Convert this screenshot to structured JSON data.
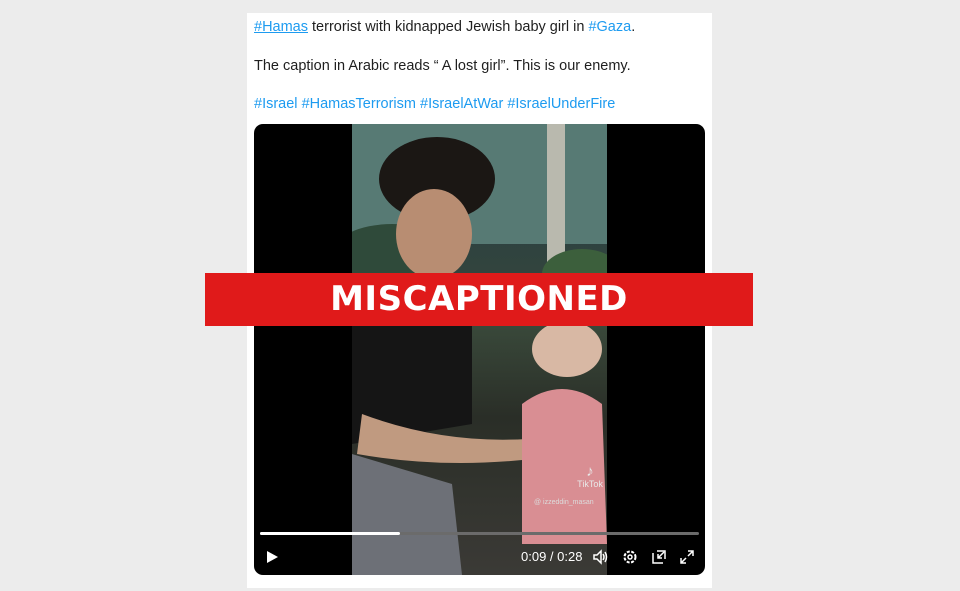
{
  "tweet": {
    "line1": {
      "tag1": "#Hamas",
      "text": " terrorist with kidnapped Jewish baby girl in ",
      "tag2": "#Gaza",
      "end": "."
    },
    "line2": "The caption in Arabic reads “ A lost girl”.  This is our enemy.",
    "hashtags": [
      "#Israel",
      "#HamasTerrorism",
      "#IsraelAtWar",
      "#IsraelUnderFire"
    ]
  },
  "video": {
    "watermark": "TikTok",
    "watermark_user": "@ izzeddin_masan",
    "time": "0:09 / 0:28",
    "progress": 0.32,
    "icons": [
      "play-icon",
      "volume-icon",
      "settings-icon",
      "picture-in-picture-icon",
      "fullscreen-icon"
    ]
  },
  "banner": {
    "label": "MISCAPTIONED",
    "color": "#e01a1a"
  },
  "colors": {
    "link": "#1d9bf0",
    "background": "#ececec"
  }
}
